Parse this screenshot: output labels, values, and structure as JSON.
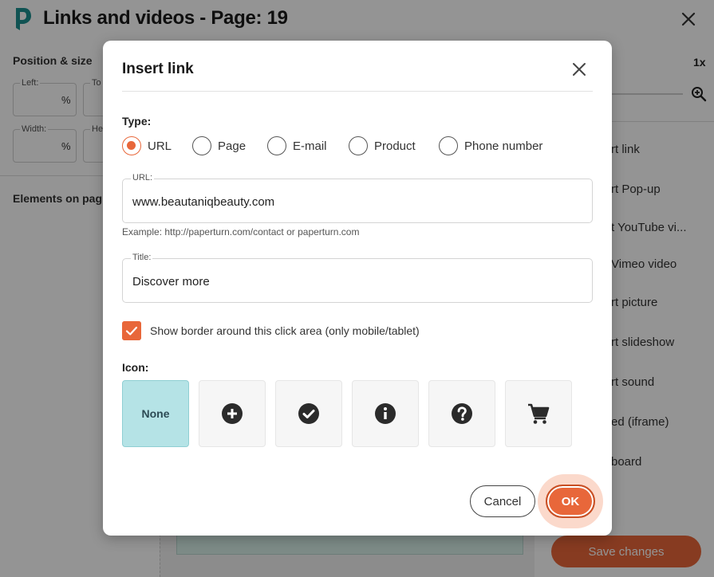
{
  "app": {
    "title": "Links and videos - Page: 19",
    "position_size_title": "Position & size",
    "fields": [
      {
        "label": "Left:",
        "unit": "%"
      },
      {
        "label": "To",
        "unit": ""
      },
      {
        "label": "Width:",
        "unit": "%"
      },
      {
        "label": "He",
        "unit": ""
      }
    ],
    "elements_title": "Elements on pag",
    "zoom_label": "1x",
    "right_items": [
      "rt link",
      "rt Pop-up",
      "t YouTube vi...",
      "Vimeo video",
      "rt picture",
      "rt slideshow",
      "rt sound",
      "ed (iframe)",
      "board"
    ],
    "save_label": "Save changes",
    "colors": {
      "accent": "#e8673a",
      "logo": "#1d8f8f",
      "selected_tile": "#b5e3e6"
    }
  },
  "dialog": {
    "title": "Insert link",
    "type_label": "Type:",
    "types": [
      {
        "label": "URL",
        "checked": true
      },
      {
        "label": "Page",
        "checked": false
      },
      {
        "label": "E-mail",
        "checked": false
      },
      {
        "label": "Product",
        "checked": false
      },
      {
        "label": "Phone number",
        "checked": false
      }
    ],
    "url": {
      "label": "URL:",
      "value": "www.beautaniqbeauty.com"
    },
    "url_help": "Example: http://paperturn.com/contact or paperturn.com",
    "title_field": {
      "label": "Title:",
      "value": "Discover more"
    },
    "border_checkbox": {
      "label": "Show border around this click area (only mobile/tablet)",
      "checked": true
    },
    "icon_label": "Icon:",
    "icons": [
      {
        "name": "none",
        "label": "None",
        "selected": true
      },
      {
        "name": "plus-circle-icon",
        "selected": false
      },
      {
        "name": "check-circle-icon",
        "selected": false
      },
      {
        "name": "info-circle-icon",
        "selected": false
      },
      {
        "name": "question-circle-icon",
        "selected": false
      },
      {
        "name": "cart-icon",
        "selected": false
      }
    ],
    "cancel_label": "Cancel",
    "ok_label": "OK"
  }
}
